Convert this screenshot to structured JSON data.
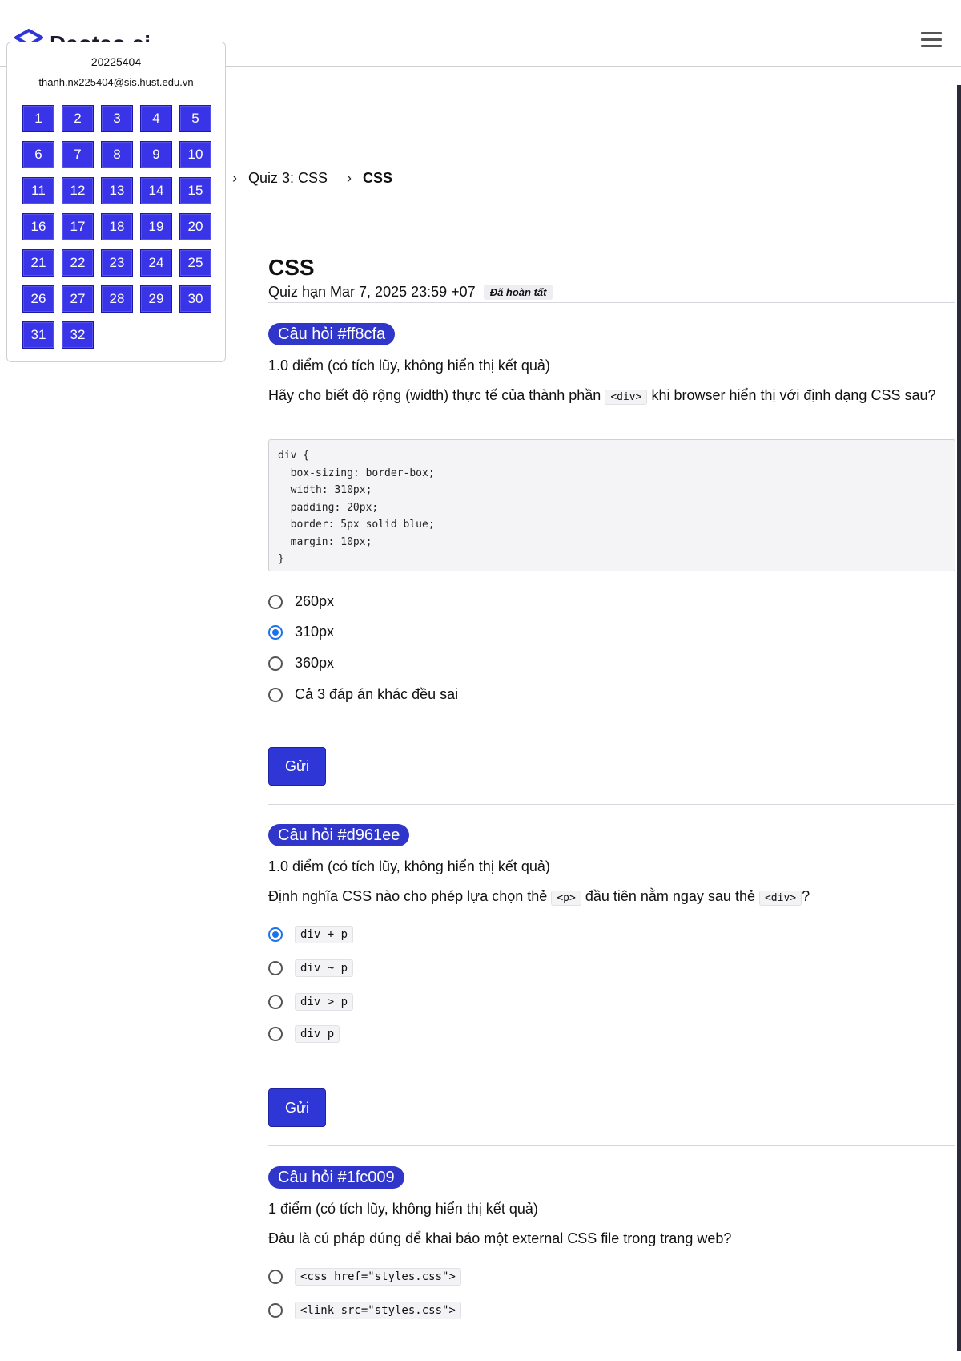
{
  "brand": {
    "name": "Daotao.ai"
  },
  "navigator": {
    "student_id": "20225404",
    "email": "thanh.nx225404@sis.hust.edu.vn",
    "questions": [
      "1",
      "2",
      "3",
      "4",
      "5",
      "6",
      "7",
      "8",
      "9",
      "10",
      "11",
      "12",
      "13",
      "14",
      "15",
      "16",
      "17",
      "18",
      "19",
      "20",
      "21",
      "22",
      "23",
      "24",
      "25",
      "26",
      "27",
      "28",
      "29",
      "30",
      "31",
      "32"
    ]
  },
  "breadcrumb": {
    "sep": "›",
    "quiz": "Quiz 3: CSS",
    "current": "CSS"
  },
  "page": {
    "title": "CSS",
    "deadline": "Quiz hạn Mar 7, 2025 23:59 +07",
    "status": "Đã hoàn tất"
  },
  "submit_label": "Gửi",
  "questions": [
    {
      "badge": "Câu hỏi #ff8cfa",
      "points": "1.0 điểm (có tích lũy, không hiển thị kết quả)",
      "text_before": "Hãy cho biết độ rộng (width) thực tế của thành phần",
      "code1": "<div>",
      "text_after": "khi browser hiển thị với định dạng CSS sau?",
      "code_block": "div {\n  box-sizing: border-box;\n  width: 310px;\n  padding: 20px;\n  border: 5px solid blue;\n  margin: 10px;\n}",
      "options": [
        "260px",
        "310px",
        "360px",
        "Cả 3 đáp án khác đều sai"
      ],
      "selected": 1
    },
    {
      "badge": "Câu hỏi #d961ee",
      "points": "1.0 điểm (có tích lũy, không hiển thị kết quả)",
      "text_before": "Định nghĩa CSS nào cho phép lựa chọn thẻ",
      "code1": "<p>",
      "text_middle": "đầu tiên nằm ngay sau thẻ",
      "code2": "<div>",
      "text_after": "?",
      "options": [
        "div + p",
        "div ~ p",
        "div > p",
        "div p"
      ],
      "selected": 0
    },
    {
      "badge": "Câu hỏi #1fc009",
      "points": "1 điểm (có tích lũy, không hiển thị kết quả)",
      "text": "Đâu là cú pháp đúng để khai báo một external CSS file trong trang web?",
      "options": [
        "<css href=\"styles.css\">",
        "<link src=\"styles.css\">"
      ],
      "selected": -1
    }
  ]
}
